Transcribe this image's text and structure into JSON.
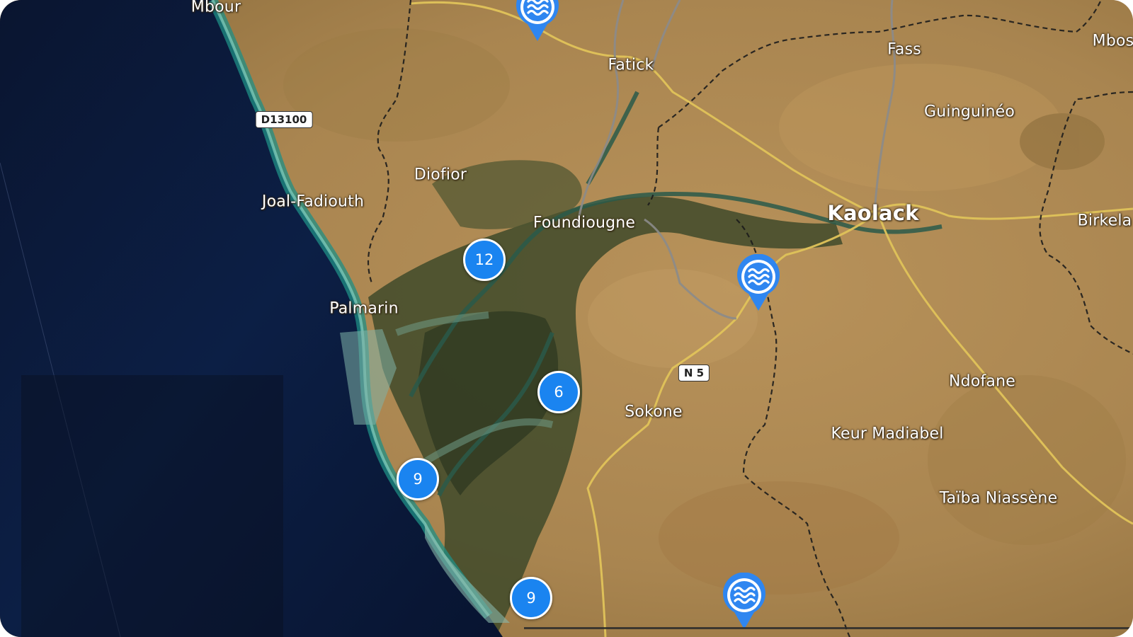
{
  "map": {
    "places": [
      {
        "id": "mbour",
        "label": "Mbour",
        "size": "md"
      },
      {
        "id": "fatick",
        "label": "Fatick",
        "size": "md"
      },
      {
        "id": "fass",
        "label": "Fass",
        "size": "md"
      },
      {
        "id": "mbos",
        "label": "Mbos",
        "size": "md"
      },
      {
        "id": "guinguineo",
        "label": "Guinguinéo",
        "size": "md"
      },
      {
        "id": "diofior",
        "label": "Diofior",
        "size": "md"
      },
      {
        "id": "joal",
        "label": "Joal-Fadiouth",
        "size": "md"
      },
      {
        "id": "foundiougne",
        "label": "Foundiougne",
        "size": "md"
      },
      {
        "id": "kaolack",
        "label": "Kaolack",
        "size": "lg"
      },
      {
        "id": "birkela",
        "label": "Birkela",
        "size": "md"
      },
      {
        "id": "palmarin",
        "label": "Palmarin",
        "size": "md"
      },
      {
        "id": "ndofane",
        "label": "Ndofane",
        "size": "md"
      },
      {
        "id": "sokone",
        "label": "Sokone",
        "size": "md"
      },
      {
        "id": "keur",
        "label": "Keur Madiabel",
        "size": "md"
      },
      {
        "id": "taiba",
        "label": "Taïba Niassène",
        "size": "md"
      }
    ],
    "road_shields": [
      {
        "id": "d13100",
        "label": "D13100"
      },
      {
        "id": "n5",
        "label": "N 5"
      }
    ],
    "clusters": [
      {
        "id": "c12",
        "count": "12"
      },
      {
        "id": "c6",
        "count": "6"
      },
      {
        "id": "c9a",
        "count": "9"
      },
      {
        "id": "c9b",
        "count": "9"
      }
    ],
    "markers": [
      {
        "id": "m1",
        "icon": "water-waves-icon"
      },
      {
        "id": "m2",
        "icon": "water-waves-icon"
      },
      {
        "id": "m3",
        "icon": "water-waves-icon"
      }
    ],
    "colors": {
      "cluster_fill": "#1a84f0",
      "marker_fill": "#2f86f0",
      "ocean": "#0c1a38",
      "land": "#b18a4f"
    }
  }
}
